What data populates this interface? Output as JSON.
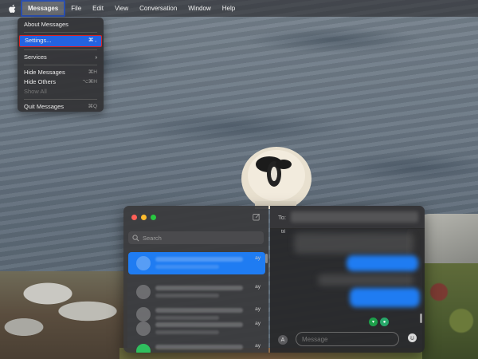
{
  "menubar": {
    "apple_icon": "apple-logo-icon",
    "items": [
      "Messages",
      "File",
      "Edit",
      "View",
      "Conversation",
      "Window",
      "Help"
    ],
    "active": "Messages"
  },
  "dropdown": {
    "about": "About Messages",
    "settings": {
      "label": "Settings...",
      "shortcut": "⌘ ,"
    },
    "services": "Services",
    "hide": {
      "label": "Hide Messages",
      "shortcut": "⌘H"
    },
    "hide_others": {
      "label": "Hide Others",
      "shortcut": "⌥⌘H"
    },
    "show_all": "Show All",
    "quit": {
      "label": "Quit Messages",
      "shortcut": "⌘Q"
    }
  },
  "window": {
    "search_placeholder": "Search",
    "conversation_days": [
      "ay",
      "ay",
      "ay",
      "ay",
      "ay"
    ],
    "to_label": "To:",
    "chat_fragment": "tri",
    "message_placeholder": "Message"
  },
  "colors": {
    "accent": "#1f7cf2",
    "highlight_border": "#dd2222",
    "menu_outline": "#2a4fb0"
  }
}
